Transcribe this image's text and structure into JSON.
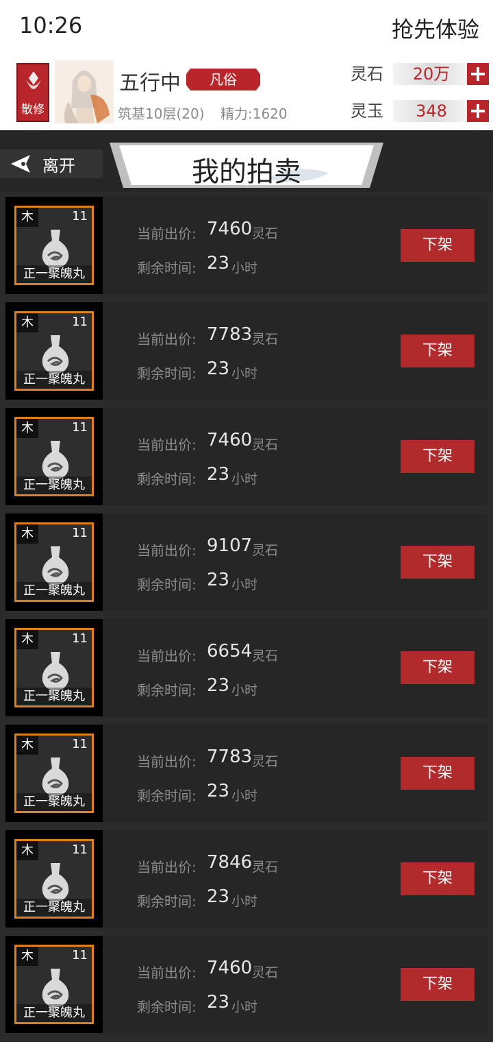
{
  "status_bar": {
    "time": "10:26",
    "promo": "抢先体验"
  },
  "player": {
    "sect_label": "散修",
    "name": "五行中",
    "rank": "凡俗",
    "realm": "筑基10层(20)",
    "energy": "精力:1620",
    "currencies": [
      {
        "label": "灵石",
        "value": "20万"
      },
      {
        "label": "灵玉",
        "value": "348"
      }
    ]
  },
  "nav": {
    "back_label": "离开",
    "title": "我的拍卖"
  },
  "colors": {
    "accent_red": "#b22a2c",
    "item_border": "#e07f1e",
    "panel_bg": "#262626"
  },
  "auction": {
    "bid_label": "当前出价:",
    "time_label": "剩余时间:",
    "bid_unit": "灵石",
    "time_unit": "小时",
    "delist_label": "下架",
    "items": [
      {
        "element": "木",
        "level": "11",
        "name": "正一聚魄丸",
        "bid": "7460",
        "time_left": "23"
      },
      {
        "element": "木",
        "level": "11",
        "name": "正一聚魄丸",
        "bid": "7783",
        "time_left": "23"
      },
      {
        "element": "木",
        "level": "11",
        "name": "正一聚魄丸",
        "bid": "7460",
        "time_left": "23"
      },
      {
        "element": "木",
        "level": "11",
        "name": "正一聚魄丸",
        "bid": "9107",
        "time_left": "23"
      },
      {
        "element": "木",
        "level": "11",
        "name": "正一聚魄丸",
        "bid": "6654",
        "time_left": "23"
      },
      {
        "element": "木",
        "level": "11",
        "name": "正一聚魄丸",
        "bid": "7783",
        "time_left": "23"
      },
      {
        "element": "木",
        "level": "11",
        "name": "正一聚魄丸",
        "bid": "7846",
        "time_left": "23"
      },
      {
        "element": "木",
        "level": "11",
        "name": "正一聚魄丸",
        "bid": "7460",
        "time_left": "23"
      }
    ]
  }
}
